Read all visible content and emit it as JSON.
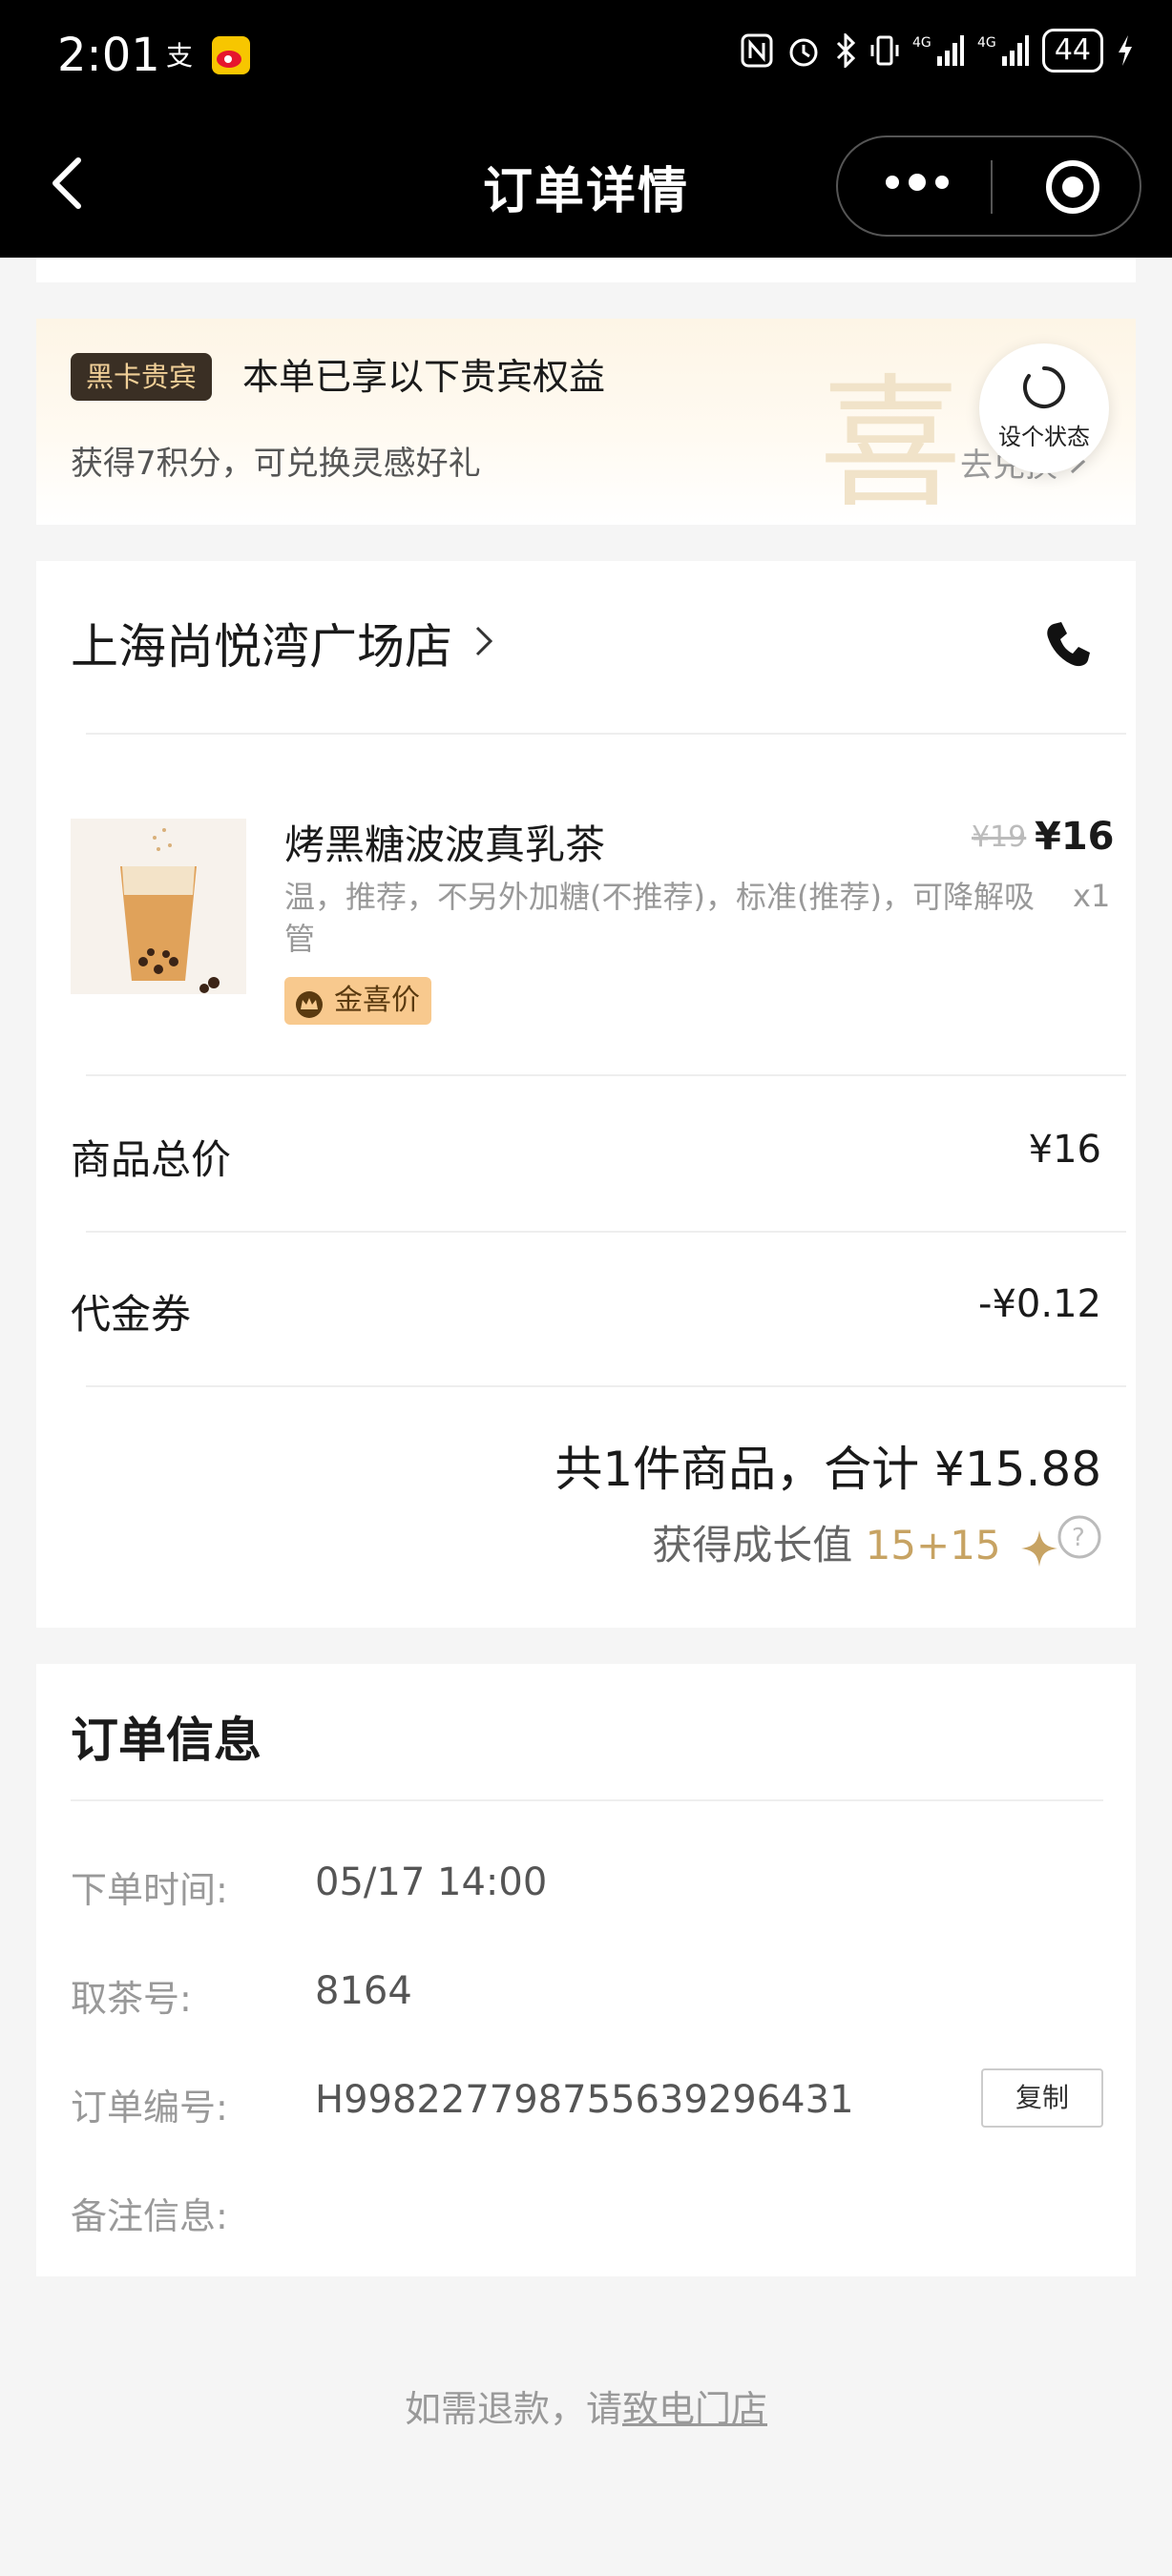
{
  "status_bar": {
    "time": "2:01",
    "app_icons": [
      "alipay-icon",
      "weibo-icon"
    ],
    "network": "4G",
    "battery": "44"
  },
  "nav": {
    "title": "订单详情"
  },
  "vip": {
    "badge": "黑卡贵宾",
    "title": "本单已享以下贵宾权益",
    "subtitle": "获得7积分，可兑换灵感好礼",
    "link": "去兑换",
    "deco_char": "喜",
    "status_button": "设个状态"
  },
  "order": {
    "store_name": "上海尚悦湾广场店",
    "product": {
      "name": "烤黑糖波波真乳茶",
      "spec": "温，推荐，不另外加糖(不推荐)，标准(推荐)，可降解吸管",
      "price_original": "¥19",
      "price": "¥16",
      "quantity": "x1",
      "tag": "金喜价"
    },
    "subtotal_label": "商品总价",
    "subtotal_value": "¥16",
    "voucher_label": "代金券",
    "voucher_value": "-¥0.12",
    "total_text": "共1件商品，合计 ¥15.88",
    "growth_label": "获得成长值",
    "growth_value": "15+15"
  },
  "info": {
    "title": "订单信息",
    "rows": [
      {
        "label": "下单时间:",
        "value": "05/17 14:00"
      },
      {
        "label": "取茶号:",
        "value": "8164"
      },
      {
        "label": "订单编号:",
        "value": "H998227798755639296431"
      },
      {
        "label": "备注信息:",
        "value": ""
      }
    ],
    "copy_button": "复制"
  },
  "footer": {
    "refund_prefix": "如需退款，请",
    "refund_link": "致电门店"
  },
  "colors": {
    "gold": "#c7a363",
    "vip_badge_bg": "#3a2f24",
    "tag_bg": "#f8c98e"
  }
}
